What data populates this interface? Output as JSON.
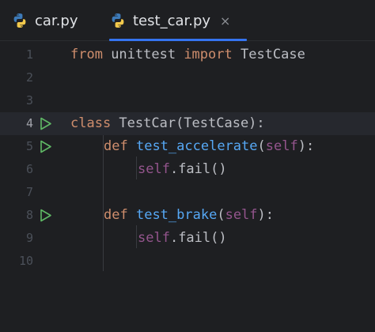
{
  "tabs": [
    {
      "label": "car.py",
      "icon": "python-file-icon",
      "active": false
    },
    {
      "label": "test_car.py",
      "icon": "python-file-icon",
      "active": true,
      "close": "×"
    }
  ],
  "colors": {
    "background": "#1e1f22",
    "keyword": "#cf8e6d",
    "function": "#56a8f5",
    "self": "#94558d",
    "text": "#bcbec4",
    "run": "#5fb865",
    "accent": "#3574f0"
  },
  "editor": {
    "current_line": 4,
    "lines": [
      {
        "num": "1",
        "t1": "from",
        "t2": " unittest ",
        "t3": "import",
        "t4": " TestCase"
      },
      {
        "num": "2"
      },
      {
        "num": "3"
      },
      {
        "num": "4",
        "run": true,
        "t1": "class",
        "t2": " TestCar(TestCase):"
      },
      {
        "num": "5",
        "run": true,
        "t1": "def",
        "t2": "test_accelerate",
        "t3": "(",
        "t4": "self",
        "t5": "):"
      },
      {
        "num": "6",
        "t1": "self",
        "t2": ".fail()"
      },
      {
        "num": "7"
      },
      {
        "num": "8",
        "run": true,
        "t1": "def",
        "t2": "test_brake",
        "t3": "(",
        "t4": "self",
        "t5": "):"
      },
      {
        "num": "9",
        "t1": "self",
        "t2": ".fail()"
      },
      {
        "num": "10"
      }
    ]
  }
}
